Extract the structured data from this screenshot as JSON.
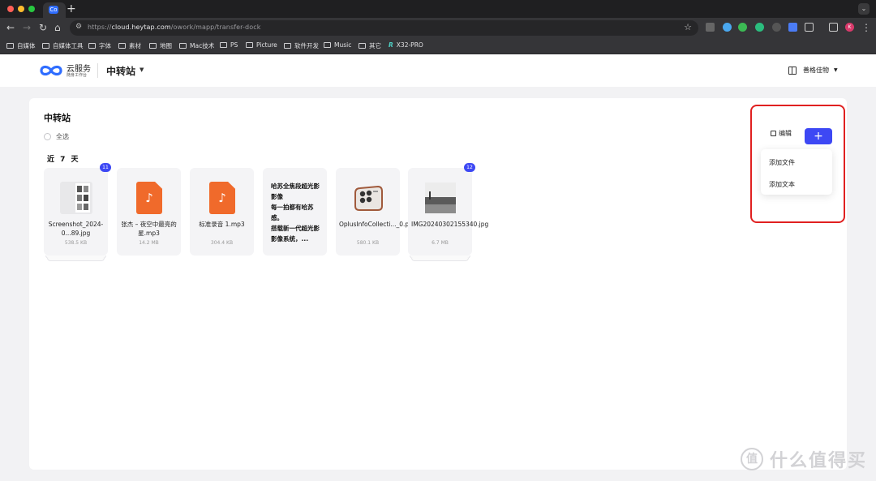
{
  "browser": {
    "tab_icon_text": "Co",
    "new_tab": "+",
    "url_prefix": "https://",
    "url_host": "cloud.heytap.com",
    "url_path": "/owork/mapp/transfer-dock",
    "bookmarks": [
      "自媒体",
      "自媒体工具",
      "字体",
      "素材",
      "地图",
      "Mac技术",
      "PS",
      "Picture",
      "软件开发",
      "Music",
      "其它",
      "X32-PRO"
    ],
    "avatar_letter": "K"
  },
  "header": {
    "brand": "云服务",
    "brand_sub": "随身工作台",
    "title": "中转站",
    "user_name": "善格佳物"
  },
  "main": {
    "page_title": "中转站",
    "select_all": "全选",
    "section_label": "近 7 天",
    "files": [
      {
        "name": "Screenshot_2024-0...89.jpg",
        "size": "538.5 KB",
        "badge": "11",
        "kind": "image-stack"
      },
      {
        "name": "张杰 – 夜空中最亮的星.mp3",
        "size": "14.2 MB",
        "kind": "audio"
      },
      {
        "name": "标准录音 1.mp3",
        "size": "304.4 KB",
        "kind": "audio"
      },
      {
        "text": "哈苏全焦段超光影影像\n每一拍都有哈苏感。\n搭载新一代超光影影像系统，...",
        "kind": "text"
      },
      {
        "name": "OplusInfoCollecti..._0.png",
        "size": "580.1 KB",
        "kind": "image"
      },
      {
        "name": "IMG20240302155340.jpg",
        "size": "6.7 MB",
        "badge": "12",
        "kind": "image-stack"
      }
    ]
  },
  "actions": {
    "edit_label": "编辑",
    "add_label": "+",
    "menu": [
      "添加文件",
      "添加文本"
    ]
  },
  "watermark": {
    "mark": "值",
    "text": "什么值得买"
  },
  "colors": {
    "accent": "#3d48f4",
    "audio_tile": "#f06a2b",
    "highlight": "#e02020"
  }
}
